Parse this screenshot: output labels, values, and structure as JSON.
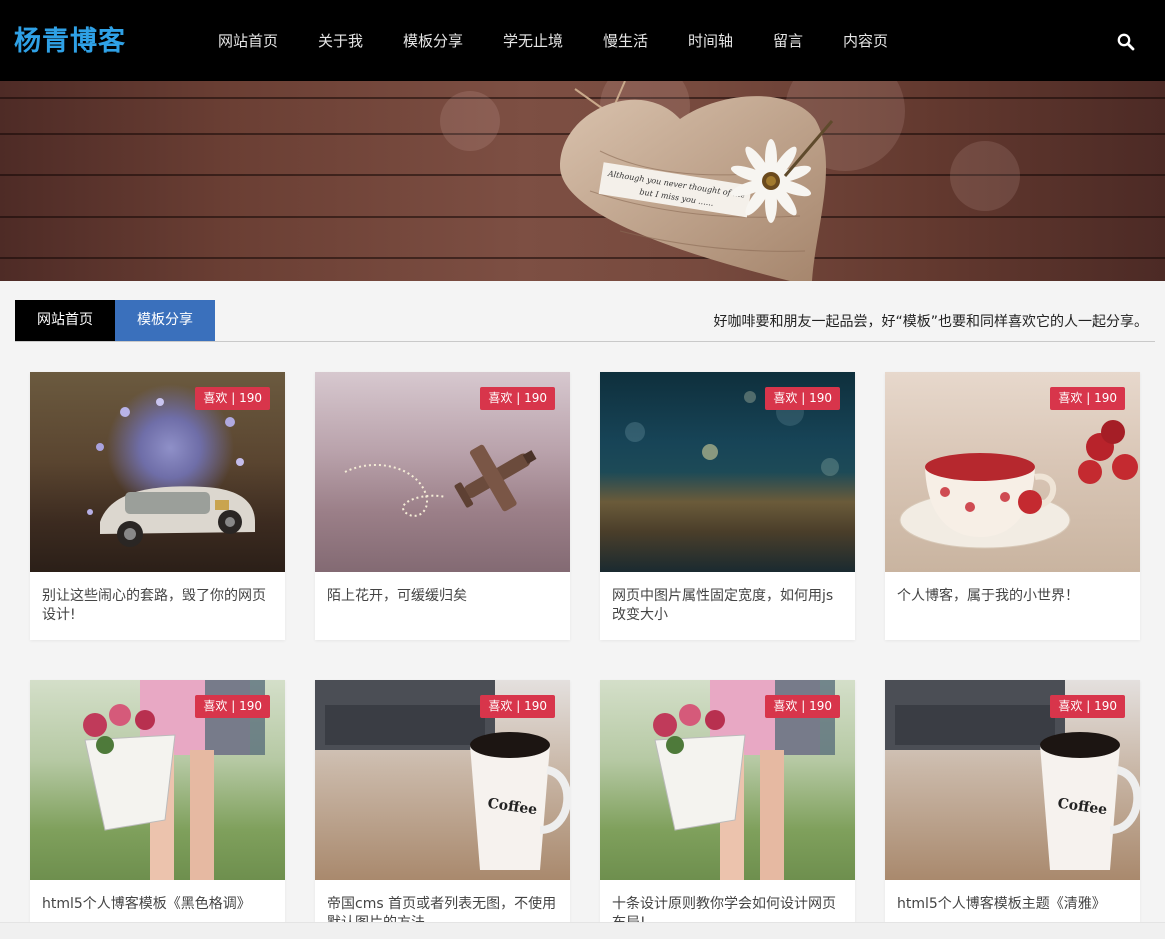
{
  "site": {
    "logo": "杨青博客"
  },
  "nav": [
    "网站首页",
    "关于我",
    "模板分享",
    "学无止境",
    "慢生活",
    "时间轴",
    "留言",
    "内容页"
  ],
  "icons": {
    "search": "search-icon"
  },
  "banner": {
    "note_line1": "Although you never thought of me",
    "note_line2": "but I miss you ......"
  },
  "tabs": [
    "网站首页",
    "模板分享"
  ],
  "slogan": "好咖啡要和朋友一起品尝，好“模板”也要和同样喜欢它的人一起分享。",
  "like_label": "喜欢 | 190",
  "cards": [
    {
      "title": "别让这些闹心的套路，毁了你的网页设计!",
      "thumb": "flower-car"
    },
    {
      "title": "陌上花开，可缓缓归矣",
      "thumb": "toy-plane"
    },
    {
      "title": "网页中图片属性固定宽度，如何用js改变大小",
      "thumb": "bokeh"
    },
    {
      "title": "个人博客，属于我的小世界！",
      "thumb": "tea-cup"
    },
    {
      "title": "html5个人博客模板《黑色格调》",
      "thumb": "flower-basket"
    },
    {
      "title": "帝国cms 首页或者列表无图，不使用默认图片的方法",
      "thumb": "coffee-laptop"
    },
    {
      "title": "十条设计原则教你学会如何设计网页布局!",
      "thumb": "flower-basket"
    },
    {
      "title": "html5个人博客模板主题《清雅》",
      "thumb": "coffee-laptop"
    }
  ],
  "colors": {
    "logo": "#2fa1e6",
    "tab_active": "#000000",
    "tab_second": "#3a70bc",
    "badge": "#d8354b"
  }
}
